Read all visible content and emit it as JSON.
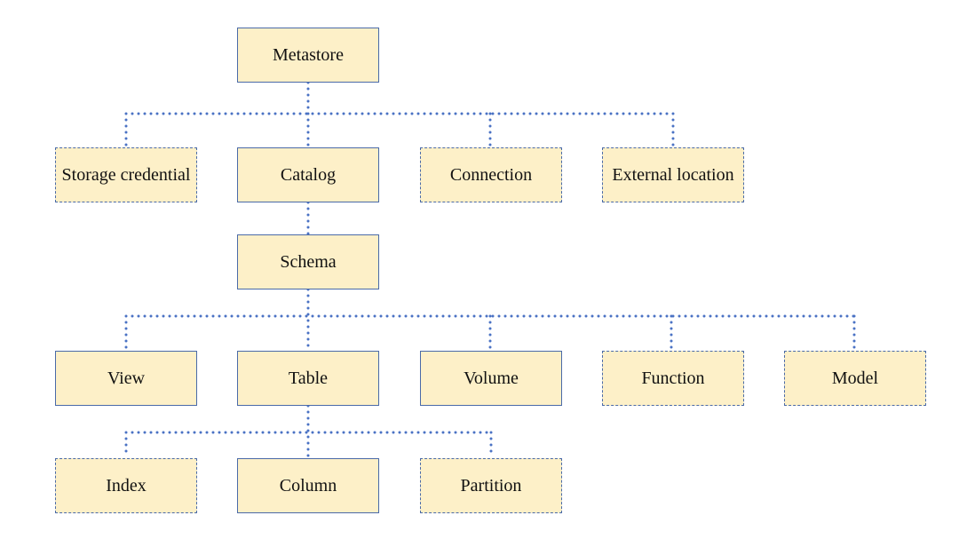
{
  "nodes": {
    "metastore": "Metastore",
    "storage_credential": "Storage credential",
    "catalog": "Catalog",
    "connection": "Connection",
    "external_location": "External location",
    "schema": "Schema",
    "view": "View",
    "table": "Table",
    "volume": "Volume",
    "function": "Function",
    "model": "Model",
    "index": "Index",
    "column": "Column",
    "partition": "Partition"
  },
  "edges": [
    [
      "metastore",
      "storage_credential"
    ],
    [
      "metastore",
      "catalog"
    ],
    [
      "metastore",
      "connection"
    ],
    [
      "metastore",
      "external_location"
    ],
    [
      "catalog",
      "schema"
    ],
    [
      "schema",
      "view"
    ],
    [
      "schema",
      "table"
    ],
    [
      "schema",
      "volume"
    ],
    [
      "schema",
      "function"
    ],
    [
      "schema",
      "model"
    ],
    [
      "table",
      "index"
    ],
    [
      "table",
      "column"
    ],
    [
      "table",
      "partition"
    ]
  ],
  "colors": {
    "fill": "#fdf0c8",
    "border": "#4a6aa8",
    "connector": "#4a72c4"
  }
}
